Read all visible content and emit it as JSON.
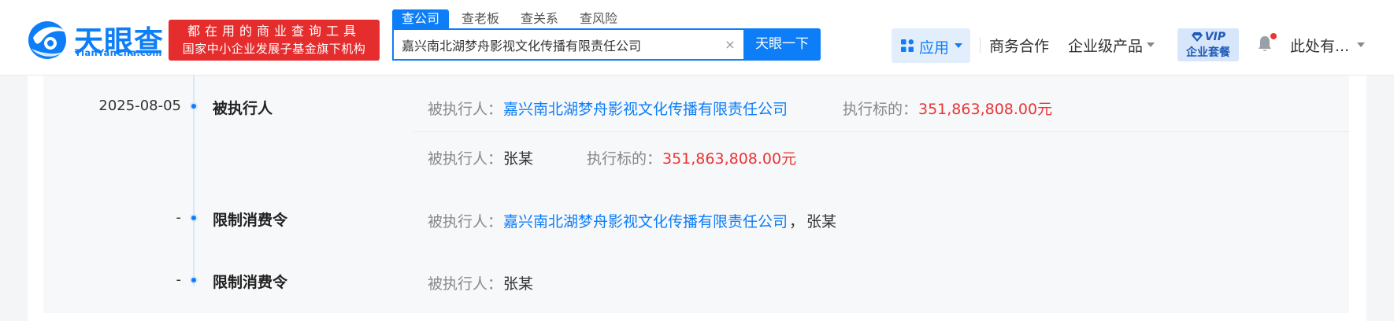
{
  "brand": {
    "name_cn": "天眼查",
    "name_en": "TianYanCha.com",
    "slogan_line1": "都在用的商业查询工具",
    "slogan_line2": "国家中小企业发展子基金旗下机构"
  },
  "search": {
    "tabs": [
      {
        "label": "查公司",
        "active": true
      },
      {
        "label": "查老板",
        "active": false
      },
      {
        "label": "查关系",
        "active": false
      },
      {
        "label": "查风险",
        "active": false
      }
    ],
    "value": "嘉兴南北湖梦舟影视文化传播有限责任公司",
    "clear_symbol": "×",
    "button": "天眼一下"
  },
  "nav": {
    "apps": "应用",
    "business": "商务合作",
    "enterprise": "企业级产品",
    "vip_line1": "VIP",
    "vip_line2": "企业套餐",
    "user": "此处有..."
  },
  "colors": {
    "brand_blue": "#0d7ef8",
    "promo_red": "#e52d2d",
    "money_red": "#e93535"
  },
  "timeline": [
    {
      "date": "2025-08-05",
      "type": "被执行人",
      "rows": [
        {
          "label1": "被执行人：",
          "value1": "嘉兴南北湖梦舟影视文化传播有限责任公司",
          "label2": "执行标的：",
          "value2": "351,863,808.00元"
        },
        {
          "label1": "被执行人：",
          "value1": "张某",
          "label2": "执行标的：",
          "value2": "351,863,808.00元"
        }
      ]
    },
    {
      "date": "-",
      "type": "限制消费令",
      "label": "被执行人：",
      "company": "嘉兴南北湖梦舟影视文化传播有限责任公司",
      "separator": "，",
      "person": "张某"
    },
    {
      "date": "-",
      "type": "限制消费令",
      "label": "被执行人：",
      "person": "张某"
    }
  ]
}
